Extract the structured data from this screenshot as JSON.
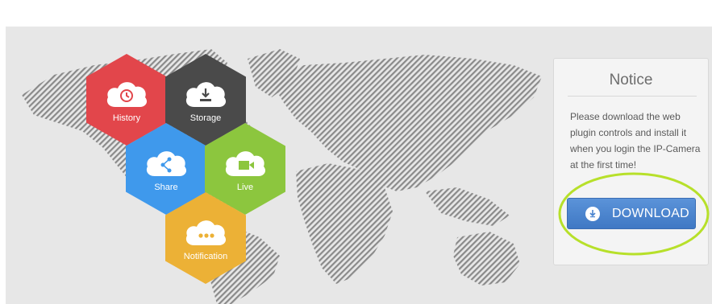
{
  "colors": {
    "history": "#e2464b",
    "storage": "#4a4a4a",
    "share": "#3f99ec",
    "live": "#8cc63e",
    "notification": "#ecb136",
    "download_button": "#4a84cf",
    "highlight_ring": "#b7e02a",
    "map_stripes": "#888888"
  },
  "features": [
    {
      "label": "History",
      "icon": "history-clock-icon"
    },
    {
      "label": "Storage",
      "icon": "download-tray-icon"
    },
    {
      "label": "Share",
      "icon": "share-icon"
    },
    {
      "label": "Live",
      "icon": "video-camera-icon"
    },
    {
      "label": "Notification",
      "icon": "ellipsis-icon"
    }
  ],
  "notice": {
    "title": "Notice",
    "message": "Please download the web plugin controls and install it when you login the IP-Camera at the first time!"
  },
  "download": {
    "label": "DOWNLOAD",
    "icon": "download-arrow-icon"
  }
}
